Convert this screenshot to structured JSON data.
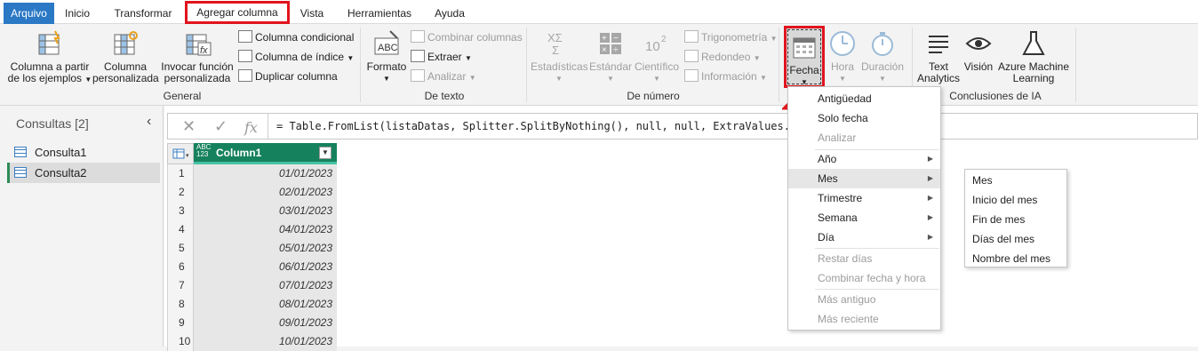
{
  "tabs": [
    "Arquivo",
    "Inicio",
    "Transformar",
    "Agregar columna",
    "Vista",
    "Herramientas",
    "Ayuda"
  ],
  "ribbon": {
    "general": {
      "label": "General",
      "col_from_examples_1": "Columna a partir",
      "col_from_examples_2": "de los ejemplos",
      "custom_col_1": "Columna",
      "custom_col_2": "personalizada",
      "invoke_fn_1": "Invocar función",
      "invoke_fn_2": "personalizada",
      "conditional": "Columna condicional",
      "index": "Columna de índice",
      "duplicate": "Duplicar columna"
    },
    "text": {
      "label": "De texto",
      "format": "Formato",
      "merge": "Combinar columnas",
      "extract": "Extraer",
      "parse": "Analizar"
    },
    "number": {
      "label": "De número",
      "stats": "Estadísticas",
      "standard": "Estándar",
      "scientific": "Científico",
      "trig": "Trigonometría",
      "rounding": "Redondeo",
      "info": "Información"
    },
    "datetime": {
      "date": "Fecha",
      "time": "Hora",
      "duration": "Duración"
    },
    "ai": {
      "label": "Conclusiones de IA",
      "text_analytics_1": "Text",
      "text_analytics_2": "Analytics",
      "vision": "Visión",
      "azure_1": "Azure Machine",
      "azure_2": "Learning"
    }
  },
  "queries": {
    "title": "Consultas [2]",
    "items": [
      "Consulta1",
      "Consulta2"
    ]
  },
  "formula": "= Table.FromList(listaDatas, Splitter.SplitByNothing(), null, null, ExtraValues.Error)",
  "table": {
    "type_label": "ABC 123",
    "column": "Column1",
    "rows": [
      {
        "n": "1",
        "v": "01/01/2023"
      },
      {
        "n": "2",
        "v": "02/01/2023"
      },
      {
        "n": "3",
        "v": "03/01/2023"
      },
      {
        "n": "4",
        "v": "04/01/2023"
      },
      {
        "n": "5",
        "v": "05/01/2023"
      },
      {
        "n": "6",
        "v": "06/01/2023"
      },
      {
        "n": "7",
        "v": "07/01/2023"
      },
      {
        "n": "8",
        "v": "08/01/2023"
      },
      {
        "n": "9",
        "v": "09/01/2023"
      },
      {
        "n": "10",
        "v": "10/01/2023"
      }
    ]
  },
  "date_menu": {
    "items": [
      "Antigüedad",
      "Solo fecha",
      "Analizar",
      "Año",
      "Mes",
      "Trimestre",
      "Semana",
      "Día",
      "Restar días",
      "Combinar fecha y hora",
      "Más antiguo",
      "Más reciente"
    ]
  },
  "month_menu": {
    "items": [
      "Mes",
      "Inicio del mes",
      "Fin de mes",
      "Días del mes",
      "Nombre del mes"
    ]
  },
  "colors": {
    "accent": "#2b78c5",
    "highlight_red": "#e0141e",
    "column_header": "#16825d"
  }
}
